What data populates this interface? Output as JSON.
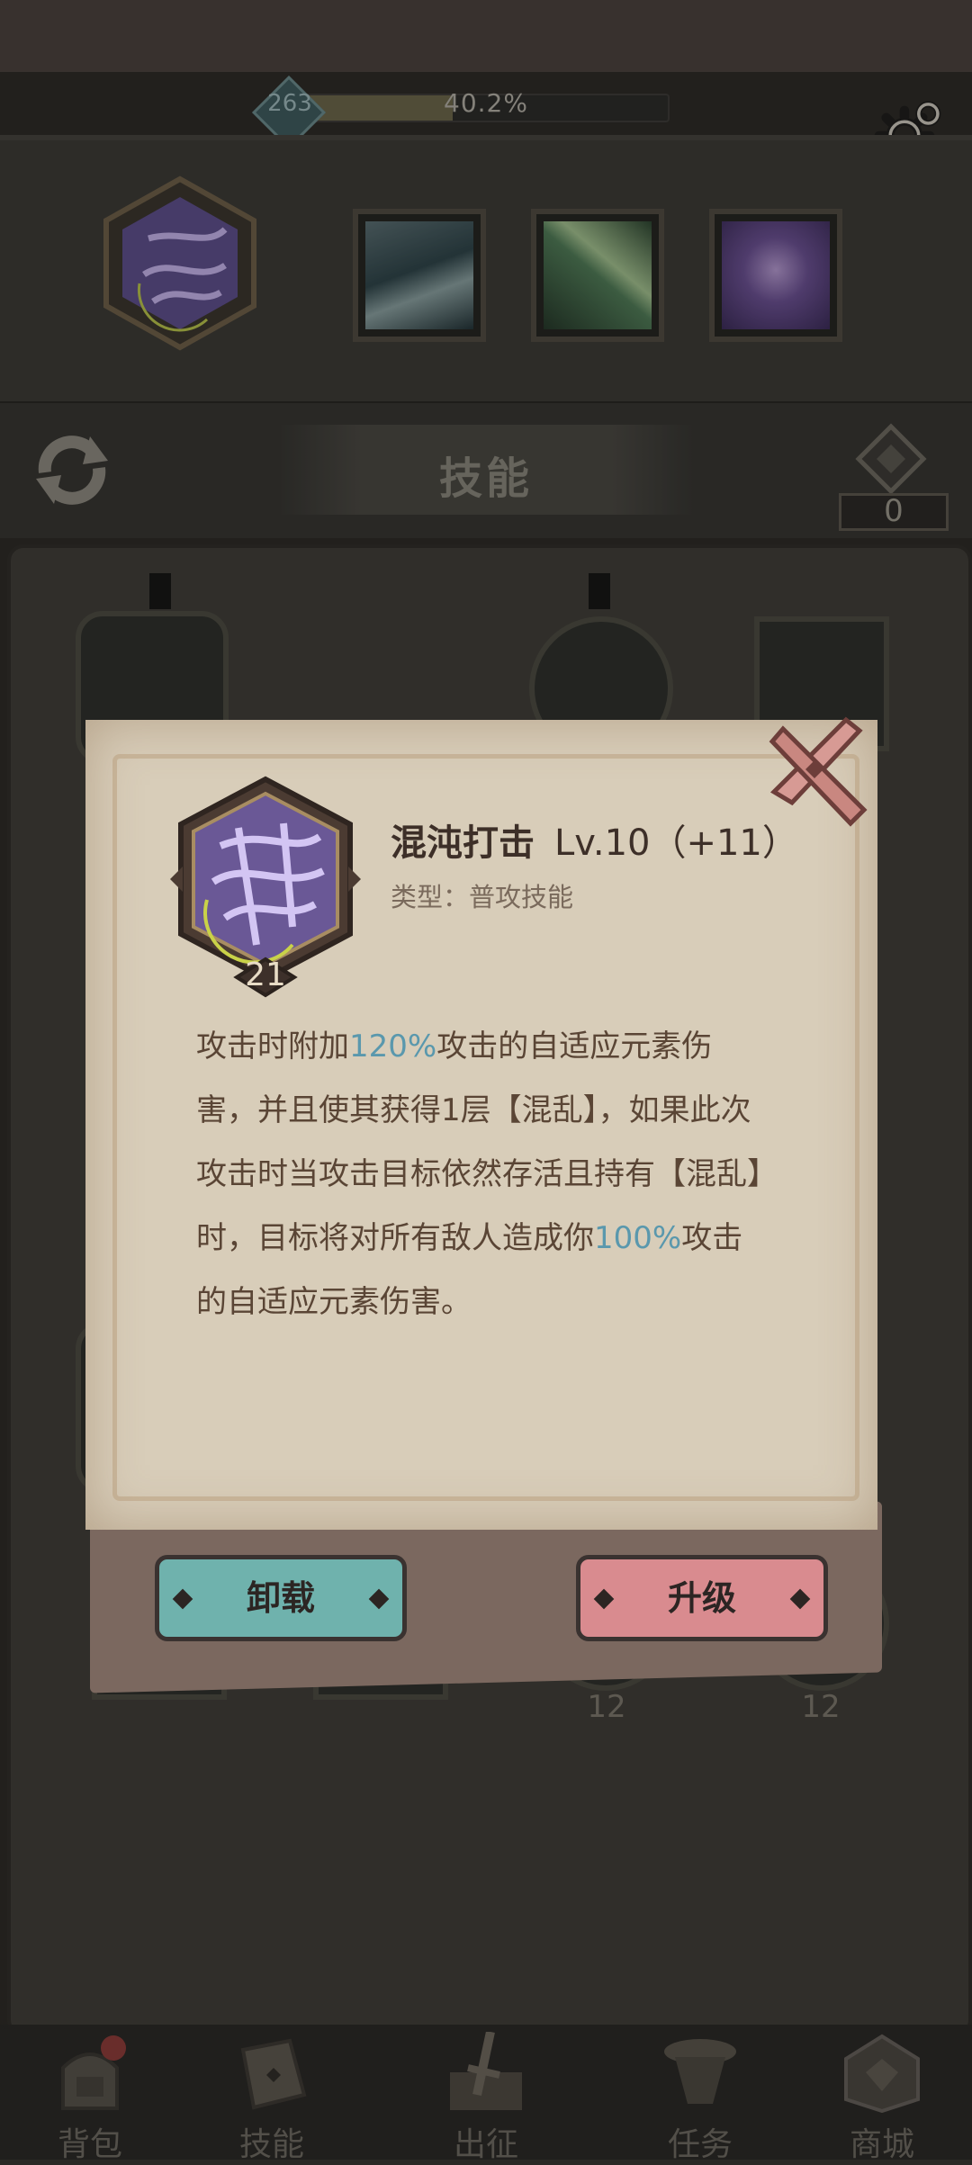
{
  "header": {
    "player_level": "263",
    "xp_percent_text": "40.2%",
    "xp_fraction": 0.402
  },
  "equipped": {
    "main_skill_icon": "chaos-strike-skill-icon",
    "slots": [
      "storm-skill-icon",
      "arrow-skill-icon",
      "void-skill-icon"
    ]
  },
  "title_bar": {
    "title": "技能",
    "skill_points": "0"
  },
  "tree": {
    "node_levels": [
      "12",
      "12"
    ]
  },
  "dialog": {
    "skill_name": "混沌打击",
    "skill_level": "Lv.10（+11）",
    "skill_type": "类型：普攻技能",
    "icon_level": "21",
    "desc_1": "攻击时附加",
    "desc_hl1": "120%",
    "desc_2": "攻击的自适应元素伤害，并且使其获得1层【混乱】，如果此次攻击时当攻击目标依然存活且持有【混乱】时，目标将对所有敌人造成你",
    "desc_hl2": "100%",
    "desc_3": "攻击的自适应元素伤害。",
    "unload_label": "卸载",
    "upgrade_label": "升级"
  },
  "nav": {
    "items": [
      {
        "label": "背包",
        "icon": "backpack-icon"
      },
      {
        "label": "技能",
        "icon": "skill-book-icon"
      },
      {
        "label": "出征",
        "icon": "sword-icon"
      },
      {
        "label": "任务",
        "icon": "scroll-icon"
      },
      {
        "label": "商城",
        "icon": "shop-icon"
      }
    ]
  },
  "colors": {
    "highlight": "#5a98ad",
    "unload_button": "#6fb2ad",
    "upgrade_button": "#d98b8f",
    "paper": "#d8cdb9"
  }
}
